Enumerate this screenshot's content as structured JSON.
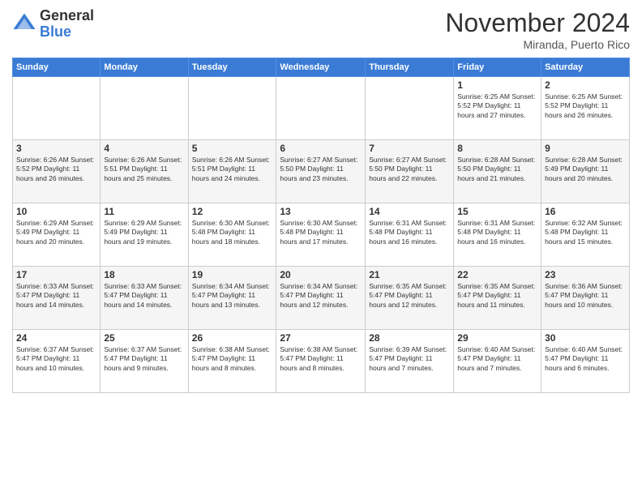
{
  "logo": {
    "general": "General",
    "blue": "Blue"
  },
  "title": "November 2024",
  "location": "Miranda, Puerto Rico",
  "days_header": [
    "Sunday",
    "Monday",
    "Tuesday",
    "Wednesday",
    "Thursday",
    "Friday",
    "Saturday"
  ],
  "weeks": [
    [
      {
        "day": "",
        "info": ""
      },
      {
        "day": "",
        "info": ""
      },
      {
        "day": "",
        "info": ""
      },
      {
        "day": "",
        "info": ""
      },
      {
        "day": "",
        "info": ""
      },
      {
        "day": "1",
        "info": "Sunrise: 6:25 AM\nSunset: 5:52 PM\nDaylight: 11 hours and 27 minutes."
      },
      {
        "day": "2",
        "info": "Sunrise: 6:25 AM\nSunset: 5:52 PM\nDaylight: 11 hours and 26 minutes."
      }
    ],
    [
      {
        "day": "3",
        "info": "Sunrise: 6:26 AM\nSunset: 5:52 PM\nDaylight: 11 hours and 26 minutes."
      },
      {
        "day": "4",
        "info": "Sunrise: 6:26 AM\nSunset: 5:51 PM\nDaylight: 11 hours and 25 minutes."
      },
      {
        "day": "5",
        "info": "Sunrise: 6:26 AM\nSunset: 5:51 PM\nDaylight: 11 hours and 24 minutes."
      },
      {
        "day": "6",
        "info": "Sunrise: 6:27 AM\nSunset: 5:50 PM\nDaylight: 11 hours and 23 minutes."
      },
      {
        "day": "7",
        "info": "Sunrise: 6:27 AM\nSunset: 5:50 PM\nDaylight: 11 hours and 22 minutes."
      },
      {
        "day": "8",
        "info": "Sunrise: 6:28 AM\nSunset: 5:50 PM\nDaylight: 11 hours and 21 minutes."
      },
      {
        "day": "9",
        "info": "Sunrise: 6:28 AM\nSunset: 5:49 PM\nDaylight: 11 hours and 20 minutes."
      }
    ],
    [
      {
        "day": "10",
        "info": "Sunrise: 6:29 AM\nSunset: 5:49 PM\nDaylight: 11 hours and 20 minutes."
      },
      {
        "day": "11",
        "info": "Sunrise: 6:29 AM\nSunset: 5:49 PM\nDaylight: 11 hours and 19 minutes."
      },
      {
        "day": "12",
        "info": "Sunrise: 6:30 AM\nSunset: 5:48 PM\nDaylight: 11 hours and 18 minutes."
      },
      {
        "day": "13",
        "info": "Sunrise: 6:30 AM\nSunset: 5:48 PM\nDaylight: 11 hours and 17 minutes."
      },
      {
        "day": "14",
        "info": "Sunrise: 6:31 AM\nSunset: 5:48 PM\nDaylight: 11 hours and 16 minutes."
      },
      {
        "day": "15",
        "info": "Sunrise: 6:31 AM\nSunset: 5:48 PM\nDaylight: 11 hours and 16 minutes."
      },
      {
        "day": "16",
        "info": "Sunrise: 6:32 AM\nSunset: 5:48 PM\nDaylight: 11 hours and 15 minutes."
      }
    ],
    [
      {
        "day": "17",
        "info": "Sunrise: 6:33 AM\nSunset: 5:47 PM\nDaylight: 11 hours and 14 minutes."
      },
      {
        "day": "18",
        "info": "Sunrise: 6:33 AM\nSunset: 5:47 PM\nDaylight: 11 hours and 14 minutes."
      },
      {
        "day": "19",
        "info": "Sunrise: 6:34 AM\nSunset: 5:47 PM\nDaylight: 11 hours and 13 minutes."
      },
      {
        "day": "20",
        "info": "Sunrise: 6:34 AM\nSunset: 5:47 PM\nDaylight: 11 hours and 12 minutes."
      },
      {
        "day": "21",
        "info": "Sunrise: 6:35 AM\nSunset: 5:47 PM\nDaylight: 11 hours and 12 minutes."
      },
      {
        "day": "22",
        "info": "Sunrise: 6:35 AM\nSunset: 5:47 PM\nDaylight: 11 hours and 11 minutes."
      },
      {
        "day": "23",
        "info": "Sunrise: 6:36 AM\nSunset: 5:47 PM\nDaylight: 11 hours and 10 minutes."
      }
    ],
    [
      {
        "day": "24",
        "info": "Sunrise: 6:37 AM\nSunset: 5:47 PM\nDaylight: 11 hours and 10 minutes."
      },
      {
        "day": "25",
        "info": "Sunrise: 6:37 AM\nSunset: 5:47 PM\nDaylight: 11 hours and 9 minutes."
      },
      {
        "day": "26",
        "info": "Sunrise: 6:38 AM\nSunset: 5:47 PM\nDaylight: 11 hours and 8 minutes."
      },
      {
        "day": "27",
        "info": "Sunrise: 6:38 AM\nSunset: 5:47 PM\nDaylight: 11 hours and 8 minutes."
      },
      {
        "day": "28",
        "info": "Sunrise: 6:39 AM\nSunset: 5:47 PM\nDaylight: 11 hours and 7 minutes."
      },
      {
        "day": "29",
        "info": "Sunrise: 6:40 AM\nSunset: 5:47 PM\nDaylight: 11 hours and 7 minutes."
      },
      {
        "day": "30",
        "info": "Sunrise: 6:40 AM\nSunset: 5:47 PM\nDaylight: 11 hours and 6 minutes."
      }
    ]
  ]
}
